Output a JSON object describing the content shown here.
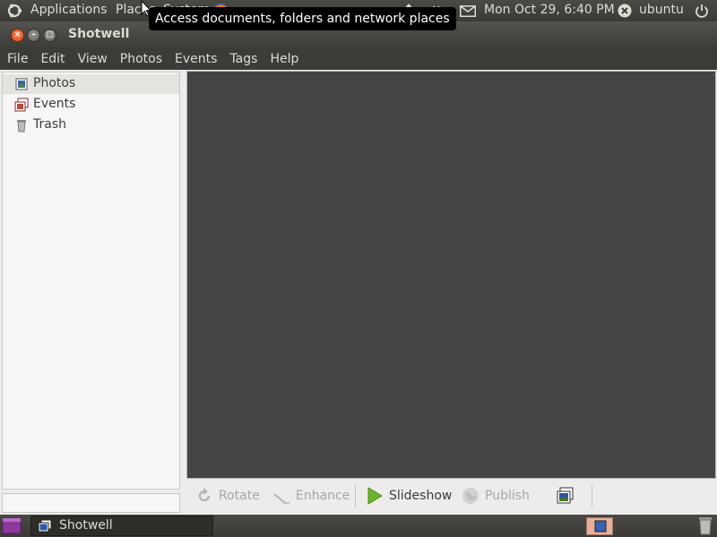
{
  "top_panel": {
    "applications": "Applications",
    "places": "Places",
    "system": "System",
    "clock": "Mon Oct 29,  6:40 PM",
    "user": "ubuntu"
  },
  "tooltip": "Access documents, folders and network places",
  "window": {
    "title": "Shotwell"
  },
  "menubar": {
    "items": [
      "File",
      "Edit",
      "View",
      "Photos",
      "Events",
      "Tags",
      "Help"
    ]
  },
  "sidebar": {
    "items": [
      {
        "label": "Photos",
        "icon": "photos-icon",
        "selected": true
      },
      {
        "label": "Events",
        "icon": "events-icon",
        "selected": false
      },
      {
        "label": "Trash",
        "icon": "trash-icon",
        "selected": false
      }
    ]
  },
  "toolbar": {
    "rotate": "Rotate",
    "enhance": "Enhance",
    "slideshow": "Slideshow",
    "publish": "Publish"
  },
  "taskbar": {
    "task_label": "Shotwell"
  },
  "colors": {
    "viewer_bg": "#444444",
    "panel_bg": "#3c3b37",
    "close_button": "#df4b16",
    "slideshow_green": "#6cb52d"
  }
}
